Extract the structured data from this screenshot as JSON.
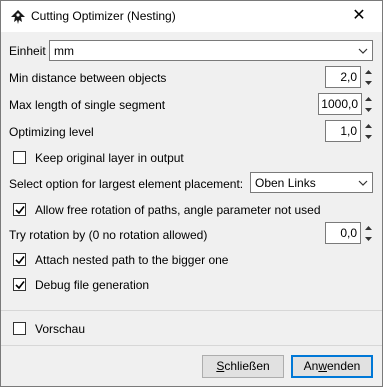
{
  "window": {
    "title": "Cutting Optimizer (Nesting)",
    "close_glyph": "✕",
    "app_icon": "inkscape-icon"
  },
  "form": {
    "unit": {
      "label": "Einheit",
      "value": "mm"
    },
    "min_distance": {
      "label": "Min distance between objects",
      "value": "2,0"
    },
    "max_length": {
      "label": "Max length of single segment",
      "value": "1000,0"
    },
    "optimizing_level": {
      "label": "Optimizing level",
      "value": "1,0"
    },
    "keep_original_layer": {
      "label": "Keep original layer in output",
      "checked": false
    },
    "placement": {
      "label": "Select option for largest element placement:",
      "value": "Oben Links"
    },
    "free_rotation": {
      "label": "Allow free rotation of paths, angle parameter not used",
      "checked": true
    },
    "try_rotation": {
      "label": "Try rotation by (0 no rotation allowed)",
      "value": "0,0"
    },
    "attach_nested": {
      "label": "Attach nested path to the bigger one",
      "checked": true
    },
    "debug_file": {
      "label": "Debug file generation",
      "checked": true
    }
  },
  "preview": {
    "label": "Vorschau",
    "checked": false
  },
  "buttons": {
    "close": {
      "prefix": "",
      "accel": "S",
      "rest": "chließen"
    },
    "apply": {
      "prefix": "An",
      "accel": "w",
      "rest": "enden"
    }
  },
  "colors": {
    "accent": "#0078d7",
    "check": "#000000"
  }
}
